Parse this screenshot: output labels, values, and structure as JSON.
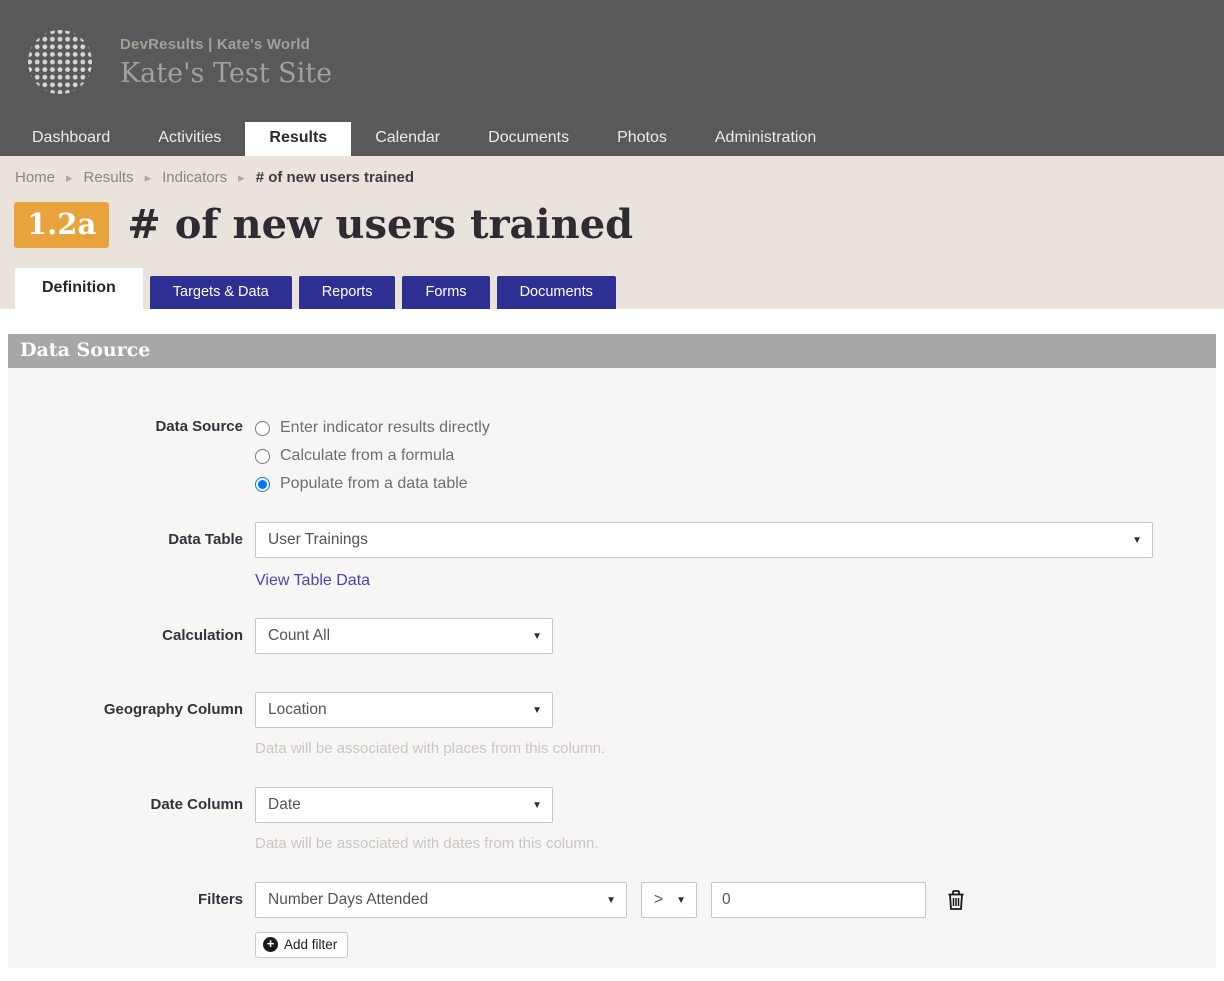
{
  "colors": {
    "header_bg": "#59585b",
    "hero_bg": "#e9e3dc",
    "badge_orange": "#e8a33c",
    "tab_navy": "#2d3092",
    "section_header_bg": "#a8a6a7",
    "form_bg": "#f7f6f5",
    "link": "#4a44b5"
  },
  "icons": {
    "dropdown_arrow": "▼",
    "plus": "+",
    "breadcrumb_separator": "▸"
  },
  "header": {
    "app_title": "DevResults | Kate's World",
    "site_title": "Kate's Test Site"
  },
  "nav": {
    "items": [
      {
        "label": "Dashboard",
        "active": false
      },
      {
        "label": "Activities",
        "active": false
      },
      {
        "label": "Results",
        "active": true
      },
      {
        "label": "Calendar",
        "active": false
      },
      {
        "label": "Documents",
        "active": false
      },
      {
        "label": "Photos",
        "active": false
      },
      {
        "label": "Administration",
        "active": false
      }
    ]
  },
  "breadcrumb": {
    "items": [
      "Home",
      "Results",
      "Indicators",
      "# of new users trained"
    ]
  },
  "page": {
    "badge": "1.2a",
    "title": "# of new users trained"
  },
  "tabs": [
    {
      "label": "Definition",
      "active": true
    },
    {
      "label": "Targets & Data",
      "active": false
    },
    {
      "label": "Reports",
      "active": false
    },
    {
      "label": "Forms",
      "active": false
    },
    {
      "label": "Documents",
      "active": false
    }
  ],
  "section": {
    "title": "Data Source"
  },
  "form": {
    "data_source": {
      "label": "Data Source",
      "options": [
        {
          "label": "Enter indicator results directly",
          "selected": false
        },
        {
          "label": "Calculate from a formula",
          "selected": false
        },
        {
          "label": "Populate from a data table",
          "selected": true
        }
      ]
    },
    "data_table": {
      "label": "Data Table",
      "value": "User Trainings",
      "link": "View Table Data"
    },
    "calculation": {
      "label": "Calculation",
      "value": "Count All"
    },
    "geography": {
      "label": "Geography Column",
      "value": "Location",
      "help": "Data will be associated with places from this column."
    },
    "date": {
      "label": "Date Column",
      "value": "Date",
      "help": "Data will be associated with dates from this column."
    },
    "filters": {
      "label": "Filters",
      "column_value": "Number Days Attended",
      "operator": ">",
      "value": "0",
      "add_label": "Add filter"
    }
  }
}
